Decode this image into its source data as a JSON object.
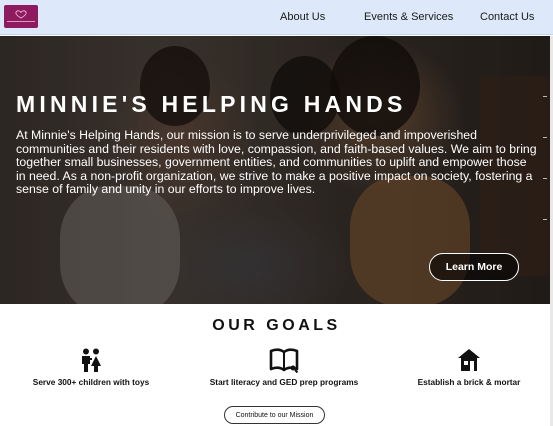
{
  "nav": {
    "logo_text": "Minnie's Helping Hands",
    "links": [
      "About Us",
      "Events & Services",
      "Contact Us"
    ]
  },
  "hero": {
    "title": "MINNIE'S HELPING HANDS",
    "description": "At Minnie's Helping Hands, our mission is to serve underprivileged and impoverished communities and their residents with love, compassion, and faith-based values. We aim to bring together small businesses, government entities, and communities to uplift and empower those in need. As a non-profit organization, we strive to make a positive impact on society, fostering a sense of family and unity in our efforts to improve lives.",
    "cta_label": "Learn More"
  },
  "goals": {
    "title": "OUR GOALS",
    "items": [
      {
        "icon": "children-icon",
        "label": "Serve 300+ children with toys"
      },
      {
        "icon": "book-icon",
        "label": "Start literacy and GED prep programs"
      },
      {
        "icon": "house-icon",
        "label": "Establish a brick & mortar"
      }
    ],
    "cta_label": "Contribute to our Mission"
  },
  "colors": {
    "nav_bg": "#dde9fa",
    "logo_bg": "#8e1a5f",
    "hero_text": "#ffffff"
  }
}
